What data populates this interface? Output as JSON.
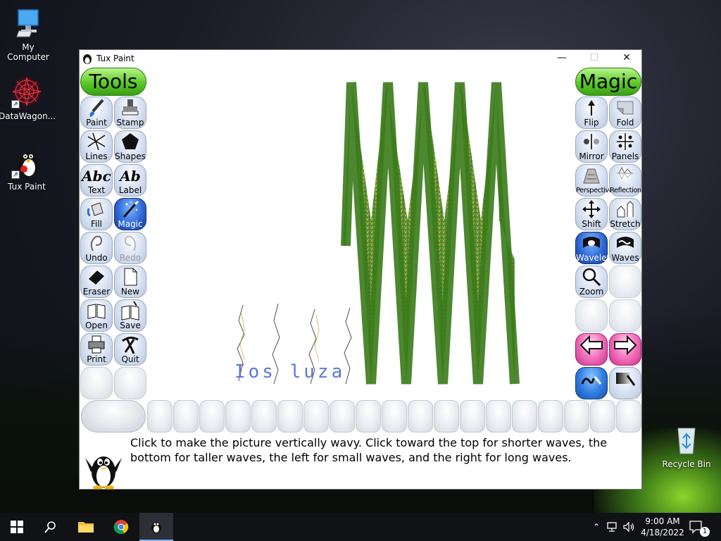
{
  "desktop": {
    "icons": [
      {
        "label": "My Computer"
      },
      {
        "label": "DataWagon..."
      },
      {
        "label": "Tux Paint"
      },
      {
        "label": "Recycle Bin"
      }
    ]
  },
  "window": {
    "title": "Tux Paint",
    "controls": {
      "minimize": "—",
      "maximize": "☐",
      "close": "✕"
    }
  },
  "tools": {
    "header": "Tools",
    "items": [
      {
        "label": "Paint"
      },
      {
        "label": "Stamp"
      },
      {
        "label": "Lines"
      },
      {
        "label": "Shapes"
      },
      {
        "label": "Text"
      },
      {
        "label": "Label"
      },
      {
        "label": "Fill"
      },
      {
        "label": "Magic"
      },
      {
        "label": "Undo"
      },
      {
        "label": "Redo"
      },
      {
        "label": "Eraser"
      },
      {
        "label": "New"
      },
      {
        "label": "Open"
      },
      {
        "label": "Save"
      },
      {
        "label": "Print"
      },
      {
        "label": "Quit"
      }
    ],
    "glyphs": {
      "text": "Abc",
      "label": "Ab"
    }
  },
  "magic": {
    "header": "Magic",
    "items": [
      {
        "label": "Flip"
      },
      {
        "label": "Fold"
      },
      {
        "label": "Mirror"
      },
      {
        "label": "Panels"
      },
      {
        "label": "Perspective"
      },
      {
        "label": "Reflection"
      },
      {
        "label": "Shift"
      },
      {
        "label": "Stretch"
      },
      {
        "label": "Wavelets"
      },
      {
        "label": "Waves"
      },
      {
        "label": "Zoom"
      }
    ]
  },
  "canvas": {
    "scribble_text": "Ios luza"
  },
  "instructions": "Click to make the picture vertically wavy. Click toward the top for shorter waves, the bottom for taller waves, the left for small waves, and the right for long waves.",
  "taskbar": {
    "time": "9:00 AM",
    "date": "4/18/2022",
    "notification_count": "1"
  },
  "colors": {
    "tools_header": "#5cc92a",
    "active_tool": "#2f6ad8",
    "nav_arrows": "#f06ab8"
  }
}
